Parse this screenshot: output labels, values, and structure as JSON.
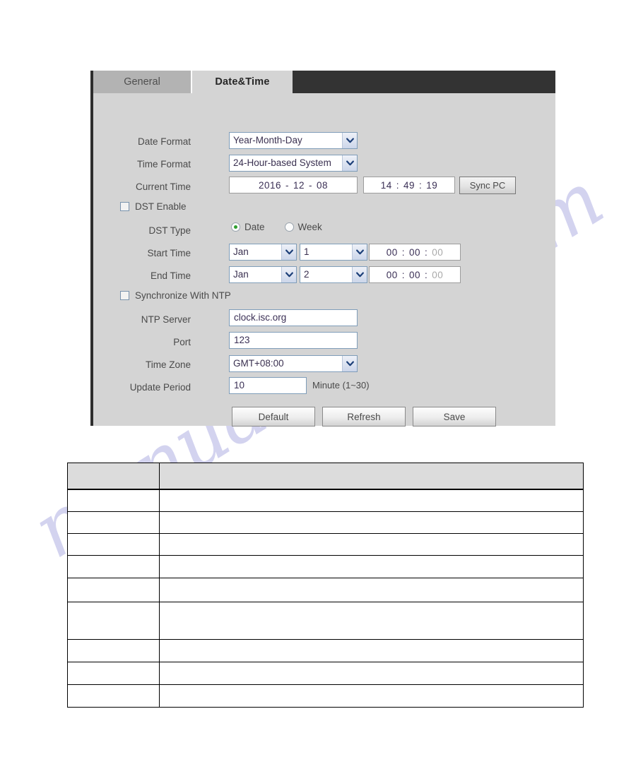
{
  "watermark": {
    "text": "manualshive.com"
  },
  "panel": {
    "tabs": [
      {
        "id": "general",
        "label": "General",
        "active": false
      },
      {
        "id": "date-time",
        "label": "Date&Time",
        "active": true
      }
    ],
    "fields": {
      "date_format": {
        "label": "Date Format",
        "value": "Year-Month-Day"
      },
      "time_format": {
        "label": "Time Format",
        "value": "24-Hour-based System"
      },
      "current_time": {
        "label": "Current Time",
        "year": "2016",
        "month": "12",
        "day": "08",
        "date_sep": "-",
        "hour": "14",
        "minute": "49",
        "second": "19",
        "time_sep": ":",
        "sync_button": "Sync PC"
      },
      "dst_enable": {
        "label": "DST Enable",
        "checked": false
      },
      "dst_type": {
        "label": "DST Type",
        "options": [
          {
            "label": "Date",
            "selected": true
          },
          {
            "label": "Week",
            "selected": false
          }
        ]
      },
      "start_time": {
        "label": "Start Time",
        "month": "Jan",
        "day": "1",
        "hour": "00",
        "minute": "00",
        "second": "00",
        "time_sep": ":"
      },
      "end_time": {
        "label": "End Time",
        "month": "Jan",
        "day": "2",
        "hour": "00",
        "minute": "00",
        "second": "00",
        "time_sep": ":"
      },
      "sync_ntp": {
        "label": "Synchronize With NTP",
        "checked": false
      },
      "ntp_server": {
        "label": "NTP Server",
        "value": "clock.isc.org"
      },
      "port": {
        "label": "Port",
        "value": "123"
      },
      "time_zone": {
        "label": "Time Zone",
        "value": "GMT+08:00"
      },
      "update_period": {
        "label": "Update Period",
        "value": "10",
        "unit": "Minute (1~30)"
      }
    },
    "buttons": {
      "default": "Default",
      "refresh": "Refresh",
      "save": "Save"
    }
  },
  "description_table": {
    "columns": [
      "",
      ""
    ],
    "rows": [
      [
        "",
        ""
      ],
      [
        "",
        ""
      ],
      [
        "",
        ""
      ],
      [
        "",
        ""
      ],
      [
        "",
        ""
      ],
      [
        "",
        ""
      ],
      [
        "",
        ""
      ],
      [
        "",
        ""
      ],
      [
        "",
        ""
      ]
    ]
  },
  "colors": {
    "panel_bg": "#d4d4d4",
    "tabbar_bg": "#333333",
    "tab_inactive_bg": "#b3b3b3",
    "input_border": "#7f9db9",
    "radio_selected": "#2f9e2f",
    "watermark": "#b9b9e6"
  }
}
